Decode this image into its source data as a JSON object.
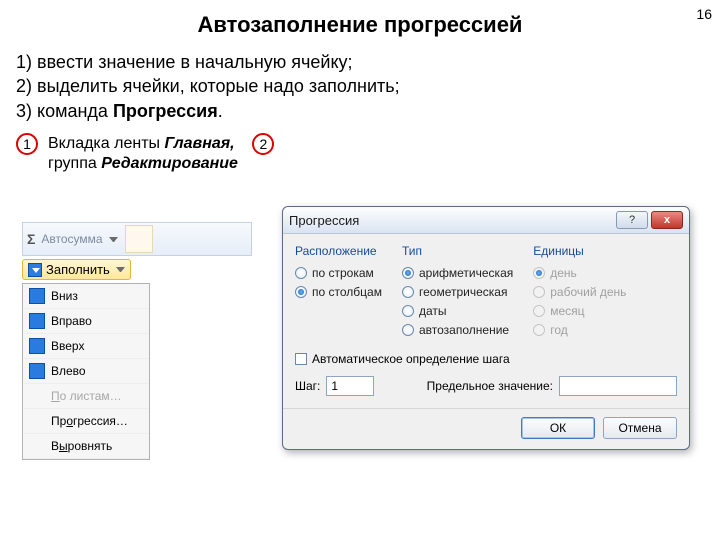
{
  "page_number": "16",
  "title": "Автозаполнение прогрессией",
  "instructions": {
    "line1": "1) ввести значение в начальную ячейку;",
    "line2": "2) выделить ячейки, которые надо заполнить;",
    "line3_prefix": "3) команда ",
    "line3_bold": "Прогрессия",
    "line3_suffix": "."
  },
  "badge1": "1",
  "badge1_text_a": "Вкладка ленты ",
  "badge1_text_b": "Главная,",
  "badge1_text_c": "группа ",
  "badge1_text_d": "Редактирование",
  "badge2": "2",
  "ribbon": {
    "autosum": "Автосумма",
    "fill": "Заполнить"
  },
  "menu": {
    "down": "Вниз",
    "right": "Вправо",
    "up": "Вверх",
    "left": "Влево",
    "sheets": "По листам…",
    "progression": "Прогрессия…",
    "justify": "Выровнять"
  },
  "dialog": {
    "title": "Прогрессия",
    "help": "?",
    "close": "x",
    "groups": {
      "layout": "Расположение",
      "type": "Тип",
      "units": "Единицы"
    },
    "layout_opts": {
      "rows": "по строкам",
      "cols": "по столбцам"
    },
    "type_opts": {
      "arith": "арифметическая",
      "geom": "геометрическая",
      "dates": "даты",
      "auto": "автозаполнение"
    },
    "units_opts": {
      "day": "день",
      "workday": "рабочий день",
      "month": "месяц",
      "year": "год"
    },
    "auto_step": "Автоматическое определение шага",
    "step_label": "Шаг:",
    "step_value": "1",
    "limit_label": "Предельное значение:",
    "limit_value": "",
    "ok": "ОК",
    "cancel": "Отмена"
  }
}
